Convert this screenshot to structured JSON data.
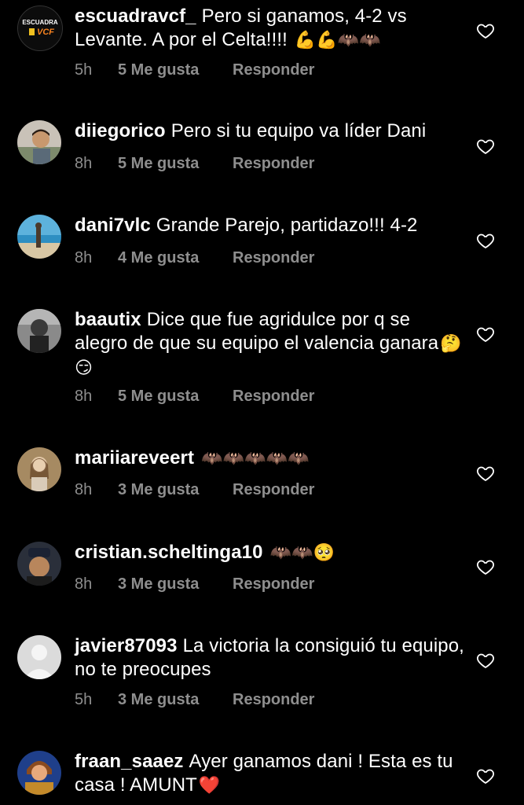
{
  "comments": [
    {
      "username": "escuadravcf_",
      "text": "Pero si ganamos, 4-2 vs Levante. A por el Celta!!!!",
      "emoji": "💪💪🦇🦇",
      "time": "5h",
      "likes": "5 Me gusta",
      "reply": "Responder",
      "avatar": "escuadra-logo",
      "avatar_text": "ESCUADRA VCF"
    },
    {
      "username": "diiegorico",
      "text": "Pero si tu equipo va líder Dani",
      "emoji": "",
      "time": "8h",
      "likes": "5 Me gusta",
      "reply": "Responder",
      "avatar": "profile-photo"
    },
    {
      "username": "dani7vlc",
      "text": "Grande Parejo, partidazo!!! 4-2",
      "emoji": "",
      "time": "8h",
      "likes": "4 Me gusta",
      "reply": "Responder",
      "avatar": "beach-photo"
    },
    {
      "username": "baautix",
      "text": "Dice que fue agridulce por q se alegro de que su equipo el valencia ganara",
      "emoji": "🤔😏",
      "time": "8h",
      "likes": "5 Me gusta",
      "reply": "Responder",
      "avatar": "bw-photo"
    },
    {
      "username": "mariiareveert",
      "text": "",
      "emoji": "🦇🦇🦇🦇🦇",
      "time": "8h",
      "likes": "3 Me gusta",
      "reply": "Responder",
      "avatar": "profile-photo"
    },
    {
      "username": "cristian.scheltinga10",
      "text": "",
      "emoji": "🦇🦇🥺",
      "time": "8h",
      "likes": "3 Me gusta",
      "reply": "Responder",
      "avatar": "profile-photo"
    },
    {
      "username": "javier87093",
      "text": "La victoria la consiguió tu equipo, no te preocupes",
      "emoji": "",
      "time": "5h",
      "likes": "3 Me gusta",
      "reply": "Responder",
      "avatar": "default-avatar"
    },
    {
      "username": "fraan_saaez",
      "text": "Ayer ganamos dani ! Esta es tu casa ! AMUNT",
      "emoji": "❤️",
      "time": "",
      "likes": "",
      "reply": "",
      "avatar": "cartoon-avatar"
    }
  ],
  "colors": {
    "background": "#000000",
    "text": "#ffffff",
    "meta": "#8e8e8e"
  }
}
